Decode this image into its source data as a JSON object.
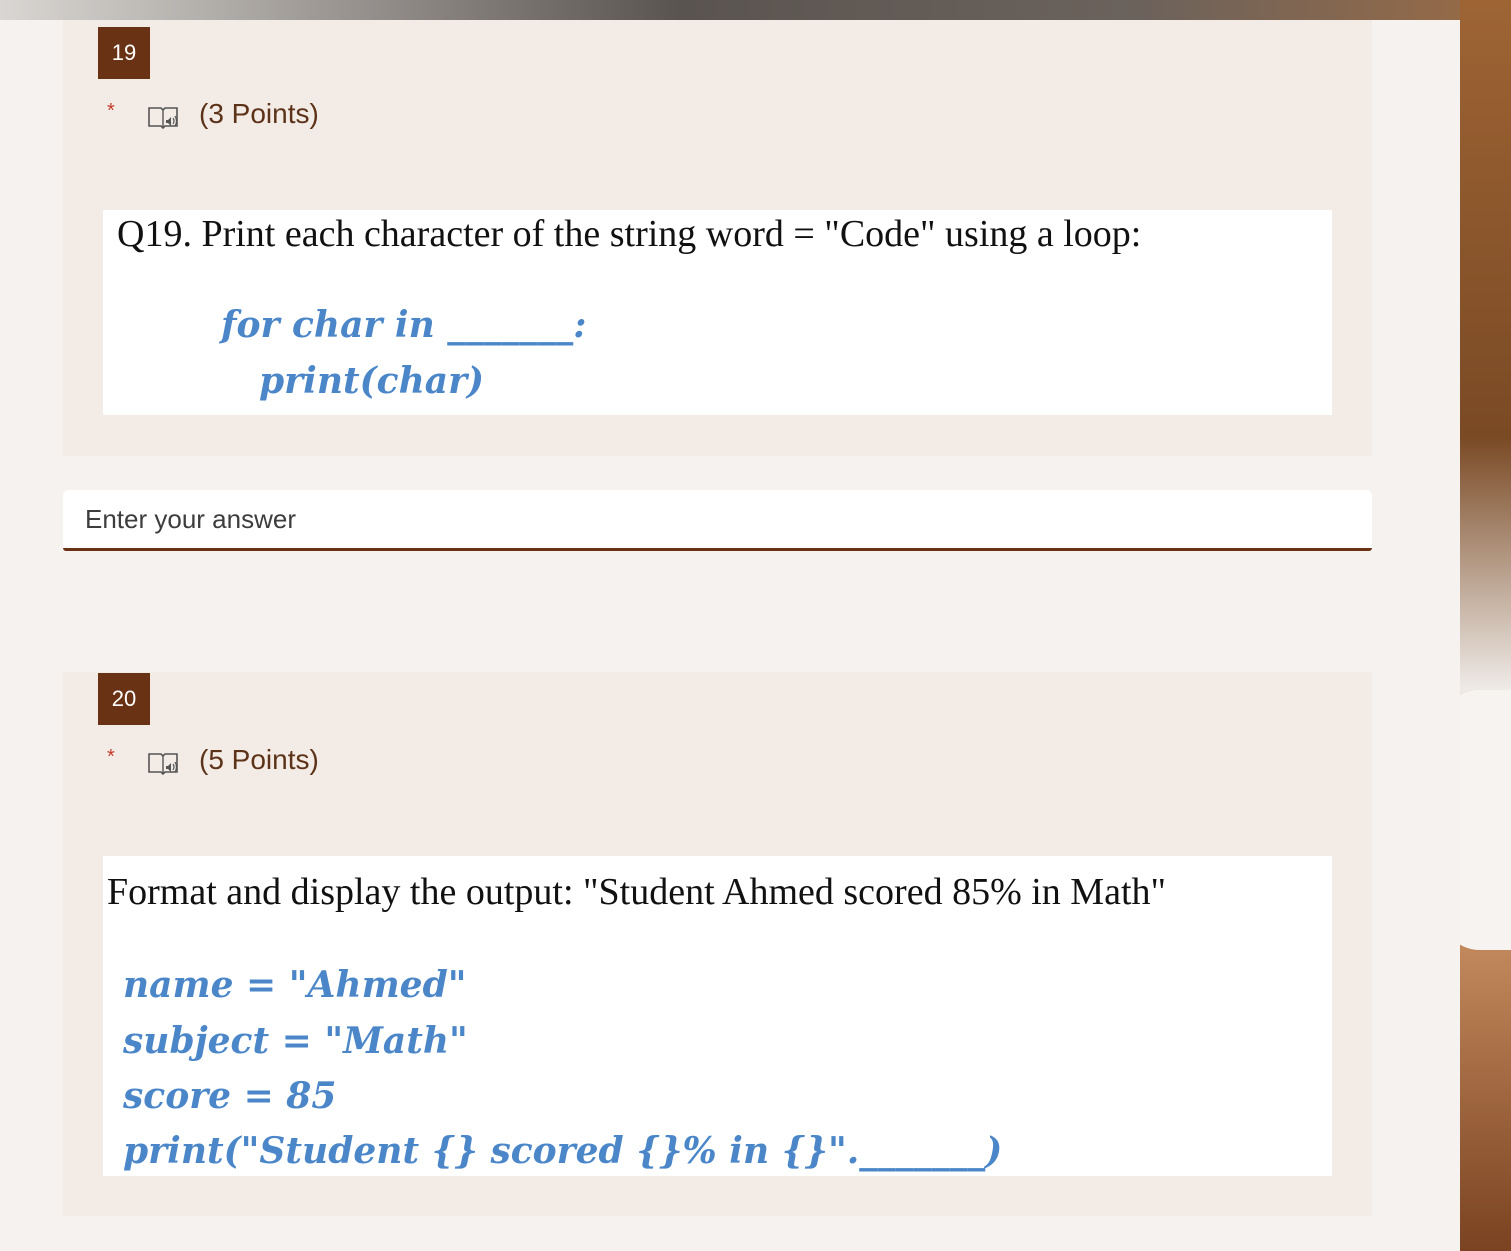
{
  "questions": [
    {
      "number": "19",
      "required_mark": "*",
      "points": "(3 Points)",
      "prompt": "Q19. Print each character of the string word = \"Code\" using a loop:",
      "code_lines": [
        "for char in _______:",
        "print(char)"
      ]
    },
    {
      "number": "20",
      "required_mark": "*",
      "points": "(5 Points)",
      "prompt": "Format and display the output: \"Student Ahmed scored 85% in Math\"",
      "code_lines": [
        "name = \"Ahmed\"",
        "subject = \"Math\"",
        "score = 85",
        "print(\"Student {} scored {}% in {}\"._______)"
      ]
    }
  ],
  "answer": {
    "placeholder": "Enter your answer",
    "value": ""
  },
  "icons": {
    "reader": "immersive-reader-icon"
  },
  "colors": {
    "badge": "#6a3215",
    "required": "#c43b2b",
    "code": "#4a86c8",
    "card": "#f3ebe6"
  }
}
